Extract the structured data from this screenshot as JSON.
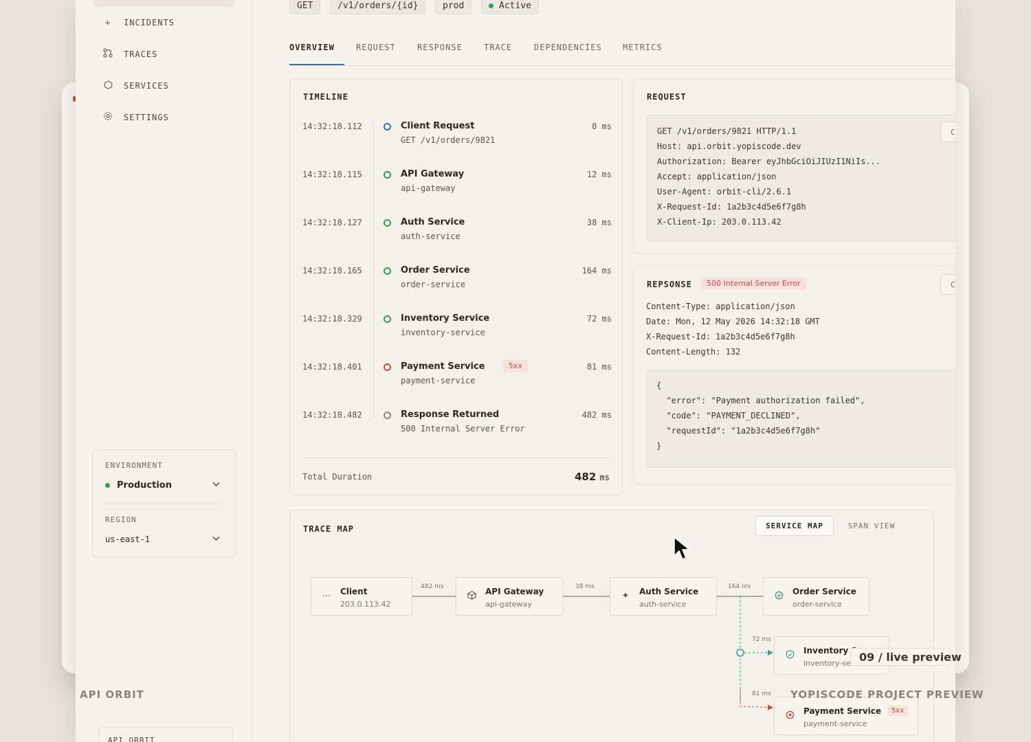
{
  "top_chips": {
    "method": "GET",
    "path": "/v1/orders/{id}",
    "env": "prod",
    "status": "Active"
  },
  "sidebar": {
    "nav": [
      {
        "label": "INCIDENTS",
        "icon": "plus-icon"
      },
      {
        "label": "TRACES",
        "icon": "traces-icon"
      },
      {
        "label": "SERVICES",
        "icon": "hexagon-icon"
      },
      {
        "label": "SETTINGS",
        "icon": "gear-icon"
      }
    ],
    "environment_label": "ENVIRONMENT",
    "environment_value": "Production",
    "region_label": "REGION",
    "region_value": "us-east-1",
    "bottom_label": "API ORBIT"
  },
  "tabs": [
    "OVERVIEW",
    "REQUEST",
    "RESPONSE",
    "TRACE",
    "DEPENDENCIES",
    "METRICS"
  ],
  "timeline": {
    "title": "TIMELINE",
    "events": [
      {
        "time": "14:32:18.112",
        "name": "Client Request",
        "sub": "GET /v1/orders/9821",
        "ms": "0 ms",
        "status": "start"
      },
      {
        "time": "14:32:18.115",
        "name": "API Gateway",
        "sub": "api-gateway",
        "ms": "12 ms",
        "status": "ok"
      },
      {
        "time": "14:32:18.127",
        "name": "Auth Service",
        "sub": "auth-service",
        "ms": "38 ms",
        "status": "ok"
      },
      {
        "time": "14:32:18.165",
        "name": "Order Service",
        "sub": "order-service",
        "ms": "164 ms",
        "status": "ok"
      },
      {
        "time": "14:32:18.329",
        "name": "Inventory Service",
        "sub": "inventory-service",
        "ms": "72 ms",
        "status": "ok"
      },
      {
        "time": "14:32:18.401",
        "name": "Payment Service",
        "sub": "payment-service",
        "ms": "81 ms",
        "status": "error",
        "badge": "5xx"
      },
      {
        "time": "14:32:18.482",
        "name": "Response Returned",
        "sub": "500 Internal Server Error",
        "ms": "482 ms",
        "status": "end"
      }
    ],
    "total_label": "Total Duration",
    "total_value": "482",
    "total_unit": "ms"
  },
  "request": {
    "title": "REQUEST",
    "lines": [
      "GET /v1/orders/9821 HTTP/1.1",
      "Host: api.orbit.yopiscode.dev",
      "Authorization: Bearer eyJhbGciOiJIUzI1NiIs...",
      "Accept: application/json",
      "User-Agent: orbit-cli/2.6.1",
      "X-Request-Id: 1a2b3c4d5e6f7g8h",
      "X-Client-Ip: 203.0.113.42"
    ],
    "copy_label": "C"
  },
  "response": {
    "title": "REPSONSE",
    "status": "500 Internal Server Error",
    "headers": [
      "Content-Type: application/json",
      "Date: Mon, 12 May 2026 14:32:18 GMT",
      "X-Request-Id: 1a2b3c4d5e6f7g8h",
      "Content-Length: 132"
    ],
    "body": [
      "{",
      "  \"error\": \"Payment authorization failed\",",
      "  \"code\": \"PAYMENT_DECLINED\",",
      "  \"requestId\": \"1a2b3c4d5e6f7g8h\"",
      "}"
    ],
    "copy_label": "C"
  },
  "trace_map": {
    "title": "TRACE MAP",
    "view_active": "SERVICE MAP",
    "view_inactive": "SPAN VIEW",
    "nodes": [
      {
        "name": "Client",
        "sub": "203.0.113.42",
        "icon": "dots-icon"
      },
      {
        "name": "API Gateway",
        "sub": "api-gateway",
        "icon": "box-icon"
      },
      {
        "name": "Auth Service",
        "sub": "auth-service",
        "icon": "sparkle-icon"
      },
      {
        "name": "Order Service",
        "sub": "order-service",
        "icon": "shield-icon"
      },
      {
        "name": "Inventory S",
        "sub": "inventory-se",
        "icon": "shield-icon"
      },
      {
        "name": "Payment Service",
        "sub": "payment-service",
        "icon": "error-shield-icon",
        "badge": "5xx"
      }
    ],
    "edges": [
      "482 ms",
      "38 ms",
      "164 ms",
      "72 ms",
      "81 ms"
    ]
  },
  "overlay": {
    "live_preview": "09 / live preview",
    "brand_left": "API ORBIT",
    "brand_right": "YOPISCODE PROJECT PREVIEW"
  },
  "colors": {
    "accent": "#3b6fb0",
    "ok": "#2f9e5b",
    "error": "#c44b3d",
    "neutral": "#8a857b"
  }
}
